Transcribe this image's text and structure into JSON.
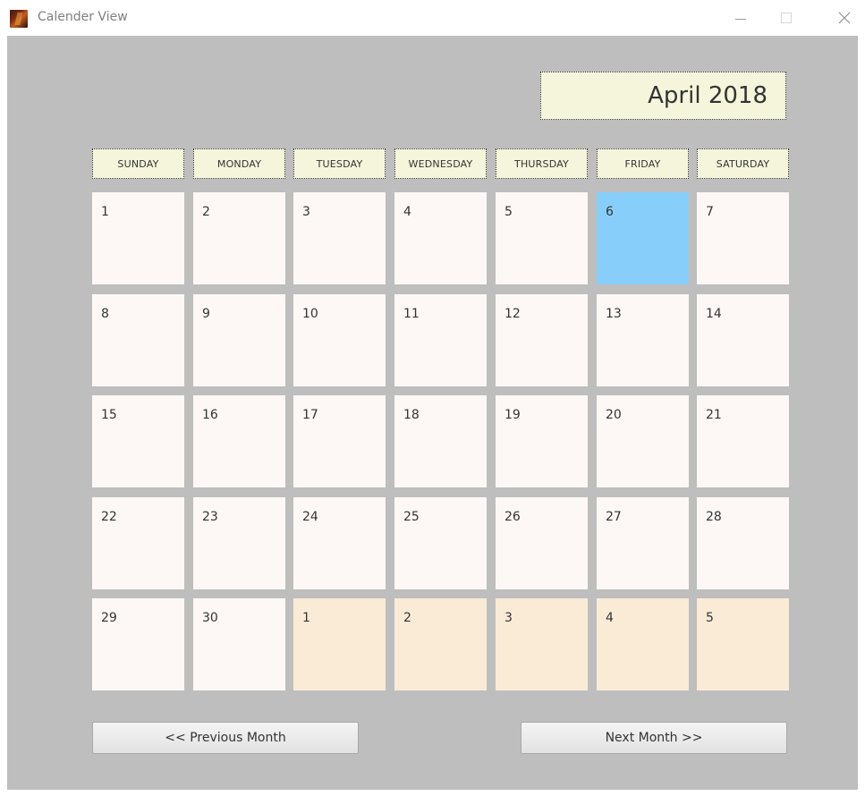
{
  "window": {
    "title": "Calender View"
  },
  "calendar": {
    "month_label": "April 2018",
    "day_headers": [
      "SUNDAY",
      "MONDAY",
      "TUESDAY",
      "WEDNESDAY",
      "THURSDAY",
      "FRIDAY",
      "SATURDAY"
    ],
    "weeks": [
      [
        {
          "day": "1",
          "state": "current"
        },
        {
          "day": "2",
          "state": "current"
        },
        {
          "day": "3",
          "state": "current"
        },
        {
          "day": "4",
          "state": "current"
        },
        {
          "day": "5",
          "state": "current"
        },
        {
          "day": "6",
          "state": "today"
        },
        {
          "day": "7",
          "state": "current"
        }
      ],
      [
        {
          "day": "8",
          "state": "current"
        },
        {
          "day": "9",
          "state": "current"
        },
        {
          "day": "10",
          "state": "current"
        },
        {
          "day": "11",
          "state": "current"
        },
        {
          "day": "12",
          "state": "current"
        },
        {
          "day": "13",
          "state": "current"
        },
        {
          "day": "14",
          "state": "current"
        }
      ],
      [
        {
          "day": "15",
          "state": "current"
        },
        {
          "day": "16",
          "state": "current"
        },
        {
          "day": "17",
          "state": "current"
        },
        {
          "day": "18",
          "state": "current"
        },
        {
          "day": "19",
          "state": "current"
        },
        {
          "day": "20",
          "state": "current"
        },
        {
          "day": "21",
          "state": "current"
        }
      ],
      [
        {
          "day": "22",
          "state": "current"
        },
        {
          "day": "23",
          "state": "current"
        },
        {
          "day": "24",
          "state": "current"
        },
        {
          "day": "25",
          "state": "current"
        },
        {
          "day": "26",
          "state": "current"
        },
        {
          "day": "27",
          "state": "current"
        },
        {
          "day": "28",
          "state": "current"
        }
      ],
      [
        {
          "day": "29",
          "state": "current"
        },
        {
          "day": "30",
          "state": "current"
        },
        {
          "day": "1",
          "state": "next-month"
        },
        {
          "day": "2",
          "state": "next-month"
        },
        {
          "day": "3",
          "state": "next-month"
        },
        {
          "day": "4",
          "state": "next-month"
        },
        {
          "day": "5",
          "state": "next-month"
        }
      ]
    ]
  },
  "navigation": {
    "prev_label": "<< Previous Month",
    "next_label": "Next Month >>"
  },
  "colors": {
    "background": "#bebebe",
    "header_bg": "#f5f5dc",
    "cell_bg": "#fdf8f6",
    "today_bg": "#87cefa",
    "next_month_bg": "#faebd7"
  }
}
